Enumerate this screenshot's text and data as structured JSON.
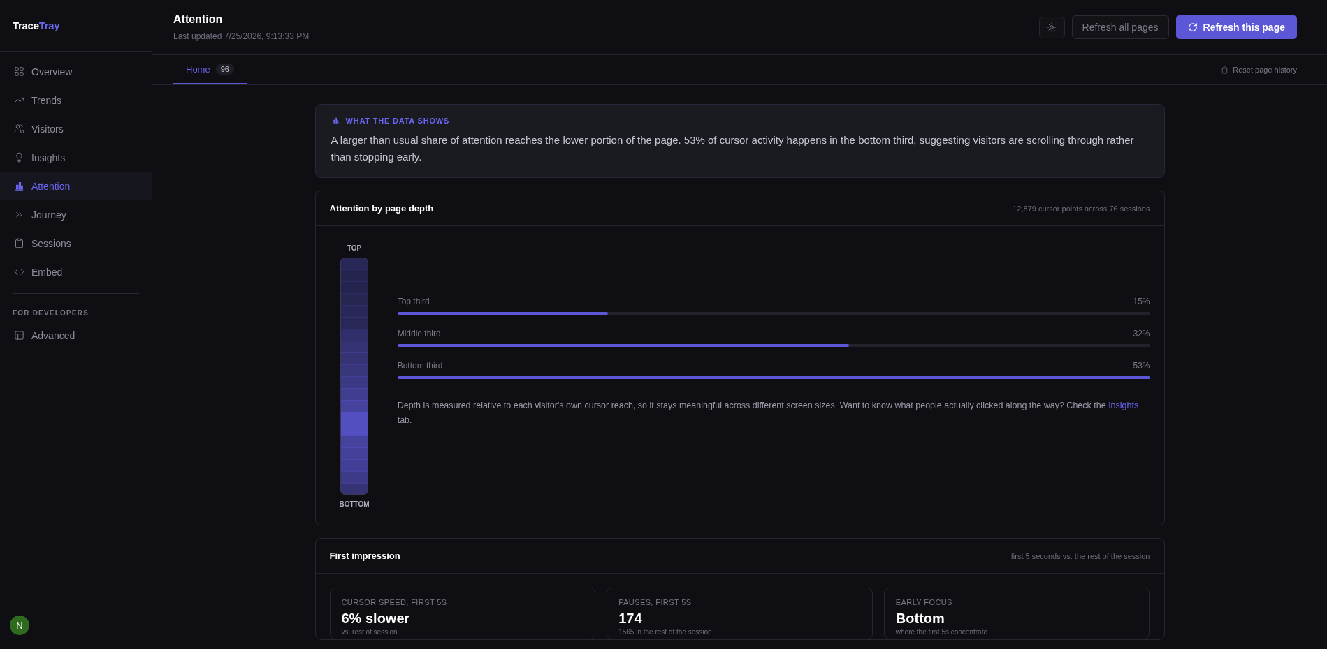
{
  "logo": {
    "part_1": "Trace",
    "part_2": "Tray"
  },
  "sidebar": {
    "items": [
      {
        "label": "Overview",
        "selected": false
      },
      {
        "label": "Trends",
        "selected": false
      },
      {
        "label": "Visitors",
        "selected": false
      },
      {
        "label": "Insights",
        "selected": false
      },
      {
        "label": "Attention",
        "selected": true
      },
      {
        "label": "Journey",
        "selected": false
      },
      {
        "label": "Sessions",
        "selected": false
      },
      {
        "label": "Embed",
        "selected": false
      }
    ],
    "section_title": "FOR DEVELOPERS",
    "dev_items": [
      {
        "label": "Advanced",
        "selected": false
      }
    ],
    "avatar": "N"
  },
  "header": {
    "title": "Attention",
    "subtitle": "Last updated 7/25/2026, 9:13:33 PM",
    "secondary_button": "Refresh all pages",
    "primary_button": "Refresh this page"
  },
  "tabs": [
    {
      "label": "Home",
      "count": "96",
      "selected": true
    }
  ],
  "reset_link": "Reset page history",
  "insight": {
    "title": "WHAT THE DATA SHOWS",
    "text": "A larger than usual share of attention reaches the lower portion of the page. 53% of cursor activity happens in the bottom third, suggesting visitors are scrolling through rather than stopping early."
  },
  "depth": {
    "title": "Attention by page depth",
    "meta": "12,879 cursor points across 76 sessions",
    "top_label": "TOP",
    "bottom_label": "BOTTOM",
    "rows": [
      {
        "label": "Top third",
        "value": "15%",
        "level": 0.28
      },
      {
        "label": "Middle third",
        "value": "32%",
        "level": 0.6
      },
      {
        "label": "Bottom third",
        "value": "53%",
        "level": 1
      }
    ],
    "note": {
      "text": "Depth is measured relative to each visitor's own cursor reach, so it stays meaningful across different screen sizes. Want to know what people actually clicked along the way? Check the",
      "link": "Insights",
      "after": "tab."
    }
  },
  "first_impression": {
    "title": "First impression",
    "meta": "first 5 seconds vs. the rest of the session",
    "stats": [
      {
        "label": "CURSOR SPEED, FIRST 5S",
        "value": "6% slower",
        "sub": "vs. rest of session"
      },
      {
        "label": "PAUSES, FIRST 5S",
        "value": "174",
        "sub": "1565 in the rest of the session"
      },
      {
        "label": "EARLY FOCUS",
        "value": "Bottom",
        "sub": "where the first 5s concentrate"
      }
    ]
  }
}
